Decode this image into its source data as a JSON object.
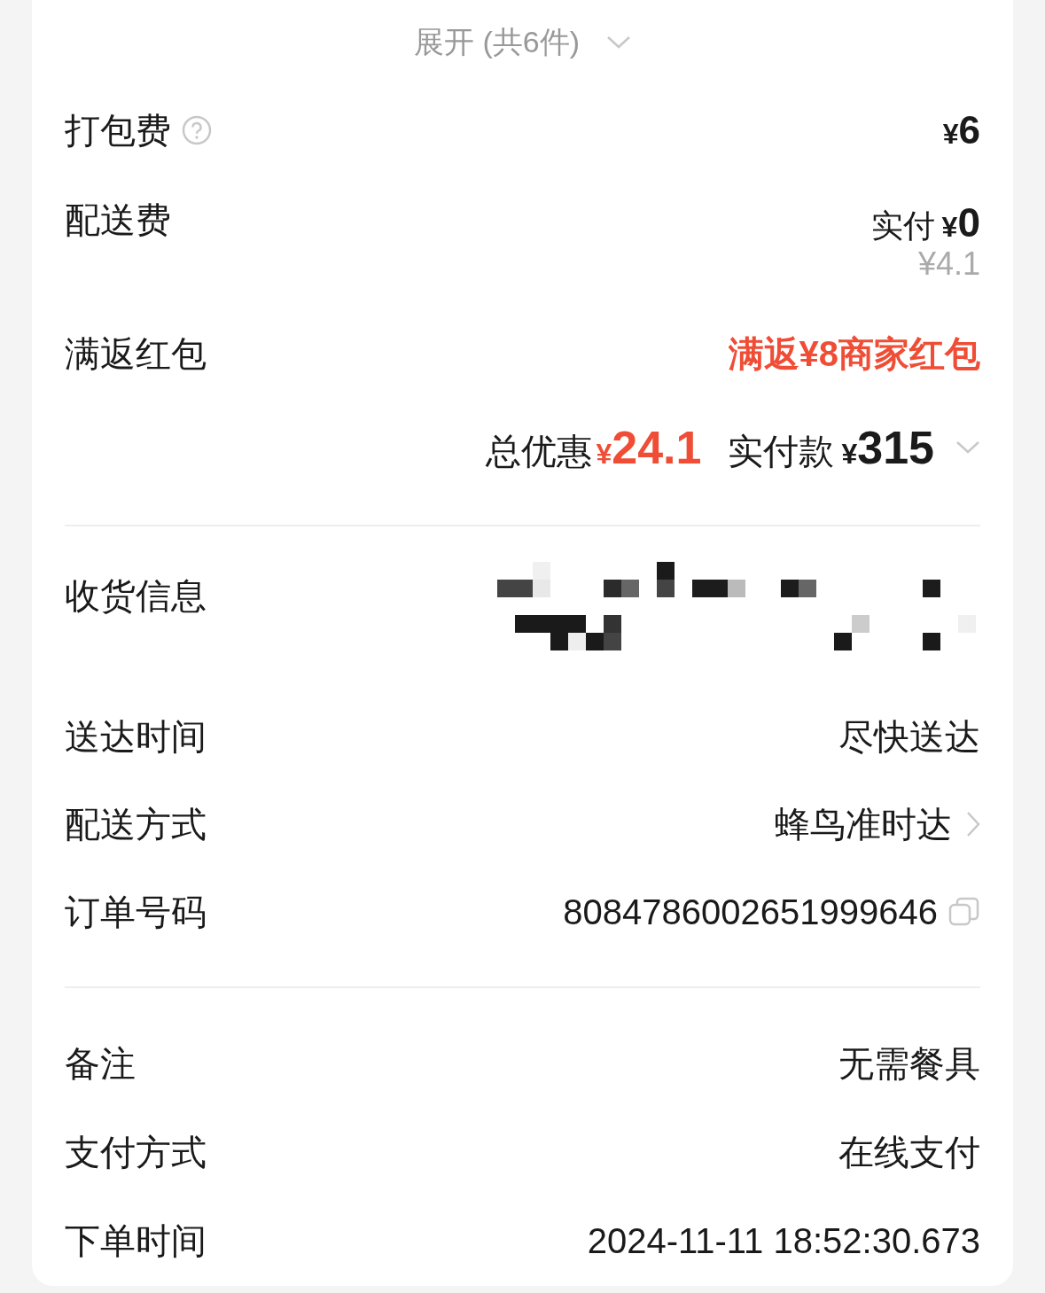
{
  "expand": {
    "label": "展开 (共6件)"
  },
  "fees": [
    {
      "kind": "amount",
      "label": "打包费",
      "help": true,
      "currency": "¥",
      "amount": "6"
    },
    {
      "kind": "paid",
      "label": "配送费",
      "help": false,
      "prefix": "实付",
      "currency": "¥",
      "amount": "0",
      "original": "¥4.1"
    },
    {
      "kind": "promo",
      "label": "满返红包",
      "help": false,
      "value": "满返¥8商家红包"
    }
  ],
  "summary": {
    "discount_label": "总优惠",
    "discount_currency": "¥",
    "discount": "24.1",
    "paid_label": "实付款",
    "paid_currency": "¥",
    "paid": "315"
  },
  "delivery": [
    {
      "kind": "redacted",
      "label": "收货信息"
    },
    {
      "kind": "text",
      "label": "送达时间",
      "value": "尽快送达"
    },
    {
      "kind": "link",
      "label": "配送方式",
      "value": "蜂鸟准时达"
    },
    {
      "kind": "copy",
      "label": "订单号码",
      "value": "8084786002651999646"
    }
  ],
  "extra": [
    {
      "label": "备注",
      "value": "无需餐具"
    },
    {
      "label": "支付方式",
      "value": "在线支付"
    },
    {
      "label": "下单时间",
      "value": "2024-11-11 18:52:30.673"
    }
  ]
}
